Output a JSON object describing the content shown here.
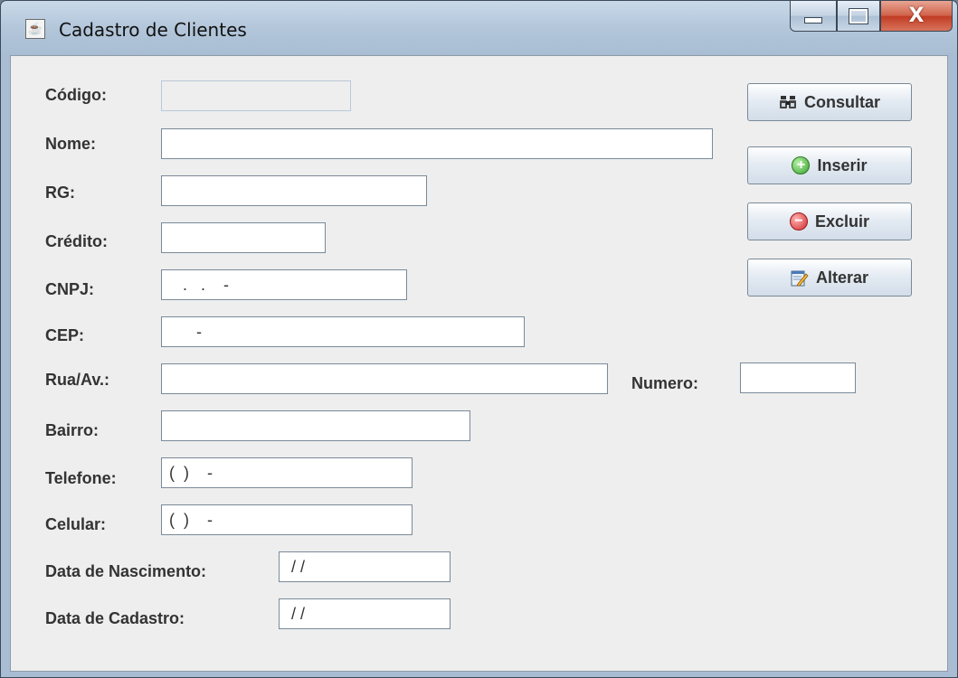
{
  "window": {
    "title": "Cadastro de Clientes",
    "app_icon": "java-coffee-icon",
    "close_glyph": "X"
  },
  "form": {
    "codigo": {
      "label": "Código:",
      "value": ""
    },
    "nome": {
      "label": "Nome:",
      "value": ""
    },
    "rg": {
      "label": "RG:",
      "value": ""
    },
    "credito": {
      "label": "Crédito:",
      "value": ""
    },
    "cnpj": {
      "label": "CNPJ:",
      "value": "   .   .    -"
    },
    "cep": {
      "label": "CEP:",
      "value": "      -"
    },
    "rua": {
      "label": "Rua/Av.:",
      "value": ""
    },
    "numero": {
      "label": "Numero:",
      "value": ""
    },
    "bairro": {
      "label": "Bairro:",
      "value": ""
    },
    "telefone": {
      "label": "Telefone:",
      "value": "(  )    -"
    },
    "celular": {
      "label": "Celular:",
      "value": "(  )    -"
    },
    "data_nascimento": {
      "label": "Data de Nascimento:",
      "value": " / /"
    },
    "data_cadastro": {
      "label": "Data de Cadastro:",
      "value": " / /"
    }
  },
  "buttons": {
    "consultar": {
      "label": "Consultar",
      "icon": "binoculars-icon"
    },
    "inserir": {
      "label": "Inserir",
      "icon": "add-circle-icon"
    },
    "excluir": {
      "label": "Excluir",
      "icon": "remove-circle-icon"
    },
    "alterar": {
      "label": "Alterar",
      "icon": "edit-document-icon"
    }
  },
  "colors": {
    "panel_background": "#eeeeee",
    "add_icon": "#3aa02c",
    "remove_icon": "#d22a2a"
  }
}
